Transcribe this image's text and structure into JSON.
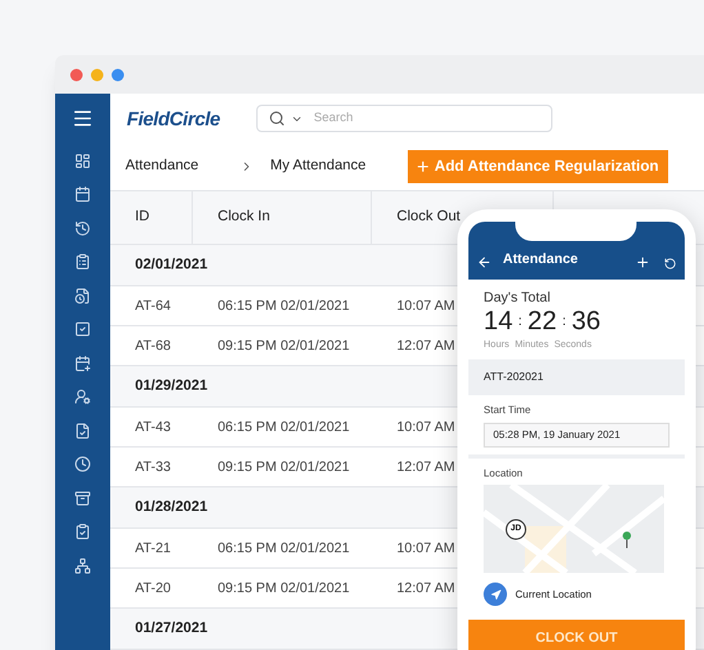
{
  "app": {
    "logo": "FieldCircle",
    "search": {
      "placeholder": "Search"
    }
  },
  "breadcrumb": [
    "Attendance",
    "My Attendance"
  ],
  "action_button": {
    "icon": "+",
    "label": "Add Attendance Regularization"
  },
  "table": {
    "columns": [
      "ID",
      "Clock In",
      "Clock Out"
    ],
    "groups": [
      {
        "date": "02/01/2021",
        "rows": [
          {
            "id": "AT-64",
            "clock_in": "06:15 PM 02/01/2021",
            "clock_out": "10:07 AM"
          },
          {
            "id": "AT-68",
            "clock_in": "09:15 PM 02/01/2021",
            "clock_out": "12:07 AM"
          }
        ]
      },
      {
        "date": "01/29/2021",
        "rows": [
          {
            "id": "AT-43",
            "clock_in": "06:15 PM 02/01/2021",
            "clock_out": "10:07 AM"
          },
          {
            "id": "AT-33",
            "clock_in": "09:15 PM 02/01/2021",
            "clock_out": "12:07 AM"
          }
        ]
      },
      {
        "date": "01/28/2021",
        "rows": [
          {
            "id": "AT-21",
            "clock_in": "06:15 PM 02/01/2021",
            "clock_out": "10:07 AM"
          },
          {
            "id": "AT-20",
            "clock_in": "09:15 PM 02/01/2021",
            "clock_out": "12:07 AM"
          }
        ]
      },
      {
        "date": "01/27/2021"
      }
    ]
  },
  "phone": {
    "title": "Attendance",
    "days_total": {
      "label": "Day's Total",
      "hours": "14",
      "minutes": "22",
      "seconds": "36",
      "separator": ":",
      "units": [
        "Hours",
        "Minutes",
        "Seconds"
      ]
    },
    "record_id": "ATT-202021",
    "start_time": {
      "label": "Start Time",
      "value": "05:28 PM, 19 January 2021"
    },
    "location": {
      "label": "Location",
      "marker": "JD",
      "current": "Current Location"
    },
    "button": "CLOCK OUT"
  }
}
